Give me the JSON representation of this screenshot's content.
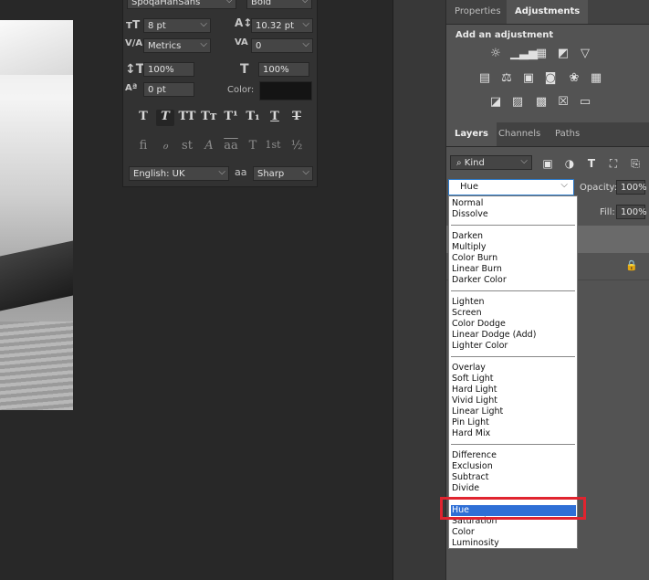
{
  "character_panel": {
    "font_family": "SpoqaHanSans",
    "font_style": "Bold",
    "font_size": "8 pt",
    "leading": "10.32 pt",
    "kerning": "Metrics",
    "tracking": "0",
    "vertical_scale": "100%",
    "horizontal_scale": "100%",
    "baseline_shift": "0 pt",
    "color_label": "Color:",
    "color": "#141414",
    "language": "English: UK",
    "antialias_icon_label": "aa",
    "antialias": "Sharp",
    "style_buttons": [
      "T",
      "T",
      "TT",
      "Tт",
      "T¹",
      "T₁",
      "T",
      "T"
    ],
    "opentype_buttons": [
      "ﬁ",
      "ℴ",
      "st",
      "A",
      "aa",
      "T",
      "1st",
      "½"
    ]
  },
  "adjustments_panel": {
    "tabs": [
      "Properties",
      "Adjustments"
    ],
    "active_tab": "Adjustments",
    "heading": "Add an adjustment"
  },
  "layers_panel": {
    "tabs": [
      "Layers",
      "Channels",
      "Paths"
    ],
    "active_tab": "Layers",
    "filter_kind": "Kind",
    "opacity_label": "Opacity:",
    "opacity_value": "100%",
    "fill_label": "Fill:",
    "fill_value": "100%",
    "blend_mode": "Hue"
  },
  "blend_modes": {
    "groups": [
      [
        "Normal",
        "Dissolve"
      ],
      [
        "Darken",
        "Multiply",
        "Color Burn",
        "Linear Burn",
        "Darker Color"
      ],
      [
        "Lighten",
        "Screen",
        "Color Dodge",
        "Linear Dodge (Add)",
        "Lighter Color"
      ],
      [
        "Overlay",
        "Soft Light",
        "Hard Light",
        "Vivid Light",
        "Linear Light",
        "Pin Light",
        "Hard Mix"
      ],
      [
        "Difference",
        "Exclusion",
        "Subtract",
        "Divide"
      ],
      [
        "Hue",
        "Saturation",
        "Color",
        "Luminosity"
      ]
    ],
    "selected": "Hue",
    "selection_color": "#2f6fd6",
    "highlight_color": "#e0242f"
  }
}
